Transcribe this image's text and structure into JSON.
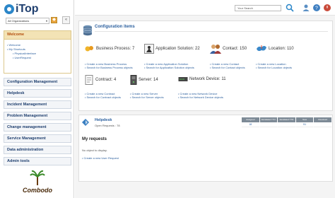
{
  "app": {
    "logo_text": "iTop",
    "brand_color": "#2b86c8"
  },
  "sidebar": {
    "org_select": {
      "value": "All Organizations",
      "arrow": "▾"
    },
    "collapse_glyph": "«",
    "welcome": {
      "title": "Welcome",
      "links": [
        "Welcome",
        "My Shortcuts",
        "PhysicalInterface",
        "UserRequest"
      ]
    },
    "menu": [
      "Configuration Management",
      "Helpdesk",
      "Incident Management",
      "Problem Management",
      "Change management",
      "Service Management",
      "Data administration",
      "Admin tools"
    ],
    "footer_logo": "Combodo"
  },
  "topbar": {
    "search_value": "Your Search",
    "icons": [
      "search-icon",
      "user-icon",
      "help-icon",
      "logoff-icon"
    ]
  },
  "config": {
    "title": "Configuration items",
    "items": [
      {
        "label": "Business Process",
        "count": "7",
        "link1": "Create a new Business Process",
        "link2": "Search for Business Process objects"
      },
      {
        "label": "Application Solution",
        "count": "22",
        "link1": "Create a new Application Solution",
        "link2": "Search for Application Solution objects"
      },
      {
        "label": "Contact",
        "count": "150",
        "link1": "Create a new Contact",
        "link2": "Search for Contact objects"
      },
      {
        "label": "Location",
        "count": "110",
        "link1": "Create a new Location",
        "link2": "Search for Location objects"
      },
      {
        "label": "Contract",
        "count": "4",
        "link1": "Create a new Contract",
        "link2": "Search for Contract objects"
      },
      {
        "label": "Server",
        "count": "14",
        "link1": "Create a new Server",
        "link2": "Search for Server objects"
      },
      {
        "label": "Network Device",
        "count": "11",
        "link1": "Create a new Network Device",
        "link2": "Search for Network Device objects"
      }
    ]
  },
  "helpdesk": {
    "title": "Helpdesk",
    "open_requests": "Open Requests : 78",
    "columns": [
      "Assigned",
      "Escalated TTO",
      "Escalated TTR",
      "New",
      "Resolved"
    ],
    "values": [
      "18",
      "",
      "",
      "51",
      ""
    ],
    "my_requests_title": "My requests",
    "no_objects": "No object to display.",
    "new_request_link": "Create a new User Request"
  }
}
